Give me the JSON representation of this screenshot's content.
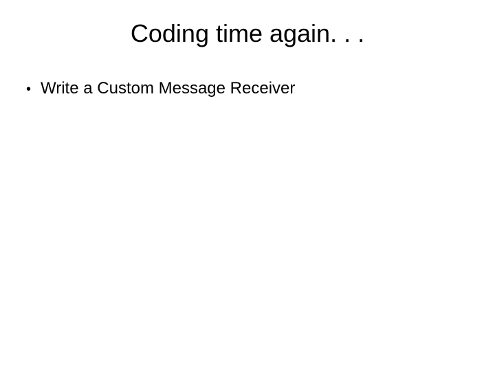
{
  "slide": {
    "title": "Coding time again. . .",
    "bullets": [
      {
        "marker": "•",
        "text": "Write a Custom Message Receiver"
      }
    ]
  }
}
